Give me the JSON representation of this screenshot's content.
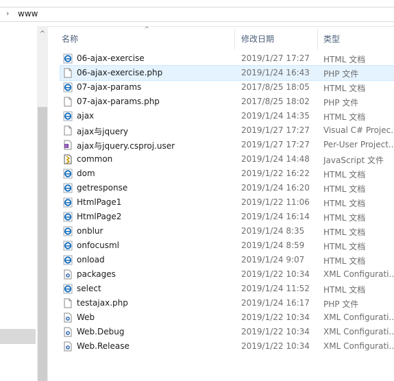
{
  "address": {
    "path": "www",
    "chevron": "›"
  },
  "nav": {
    "scroll_up": "^"
  },
  "columns": {
    "name": "名称",
    "date": "修改日期",
    "type": "类型",
    "sort_indicator": "^"
  },
  "files": [
    {
      "name": "06-ajax-exercise",
      "date": "2019/1/27 17:27",
      "type": "HTML 文档",
      "icon": "ie-html-icon"
    },
    {
      "name": "06-ajax-exercise.php",
      "date": "2019/1/24 16:43",
      "type": "PHP 文件",
      "icon": "blank-file-icon",
      "selected": true
    },
    {
      "name": "07-ajax-params",
      "date": "2017/8/25 18:05",
      "type": "HTML 文档",
      "icon": "ie-html-icon"
    },
    {
      "name": "07-ajax-params.php",
      "date": "2017/8/25 18:02",
      "type": "PHP 文件",
      "icon": "blank-file-icon"
    },
    {
      "name": "ajax",
      "date": "2019/1/24 14:35",
      "type": "HTML 文档",
      "icon": "ie-html-icon"
    },
    {
      "name": "ajax与jquery",
      "date": "2019/1/27 17:27",
      "type": "Visual C# Projec...",
      "icon": "blank-file-icon"
    },
    {
      "name": "ajax与jquery.csproj.user",
      "date": "2019/1/27 17:27",
      "type": "Per-User Project...",
      "icon": "csproj-user-icon"
    },
    {
      "name": "common",
      "date": "2019/1/24 14:48",
      "type": "JavaScript 文件",
      "icon": "javascript-file-icon"
    },
    {
      "name": "dom",
      "date": "2019/1/22 16:22",
      "type": "HTML 文档",
      "icon": "ie-html-icon"
    },
    {
      "name": "getresponse",
      "date": "2019/1/24 16:20",
      "type": "HTML 文档",
      "icon": "ie-html-icon"
    },
    {
      "name": "HtmlPage1",
      "date": "2019/1/22 11:06",
      "type": "HTML 文档",
      "icon": "ie-html-icon"
    },
    {
      "name": "HtmlPage2",
      "date": "2019/1/24 16:14",
      "type": "HTML 文档",
      "icon": "ie-html-icon"
    },
    {
      "name": "onblur",
      "date": "2019/1/24 8:35",
      "type": "HTML 文档",
      "icon": "ie-html-icon"
    },
    {
      "name": "onfocusml",
      "date": "2019/1/24 8:59",
      "type": "HTML 文档",
      "icon": "ie-html-icon"
    },
    {
      "name": "onload",
      "date": "2019/1/24 9:07",
      "type": "HTML 文档",
      "icon": "ie-html-icon"
    },
    {
      "name": "packages",
      "date": "2019/1/22 10:34",
      "type": "XML Configurati...",
      "icon": "xml-config-icon"
    },
    {
      "name": "select",
      "date": "2019/1/24 11:52",
      "type": "HTML 文档",
      "icon": "ie-html-icon"
    },
    {
      "name": "testajax.php",
      "date": "2019/1/24 16:17",
      "type": "PHP 文件",
      "icon": "blank-file-icon"
    },
    {
      "name": "Web",
      "date": "2019/1/22 10:34",
      "type": "XML Configurati...",
      "icon": "xml-config-icon"
    },
    {
      "name": "Web.Debug",
      "date": "2019/1/22 10:34",
      "type": "XML Configurati...",
      "icon": "xml-config-icon"
    },
    {
      "name": "Web.Release",
      "date": "2019/1/22 10:34",
      "type": "XML Configurati...",
      "icon": "xml-config-icon"
    }
  ],
  "colors": {
    "selected_row": "#e5f3ff",
    "header_text": "#4c607a",
    "ie_blue": "#1e73be"
  }
}
